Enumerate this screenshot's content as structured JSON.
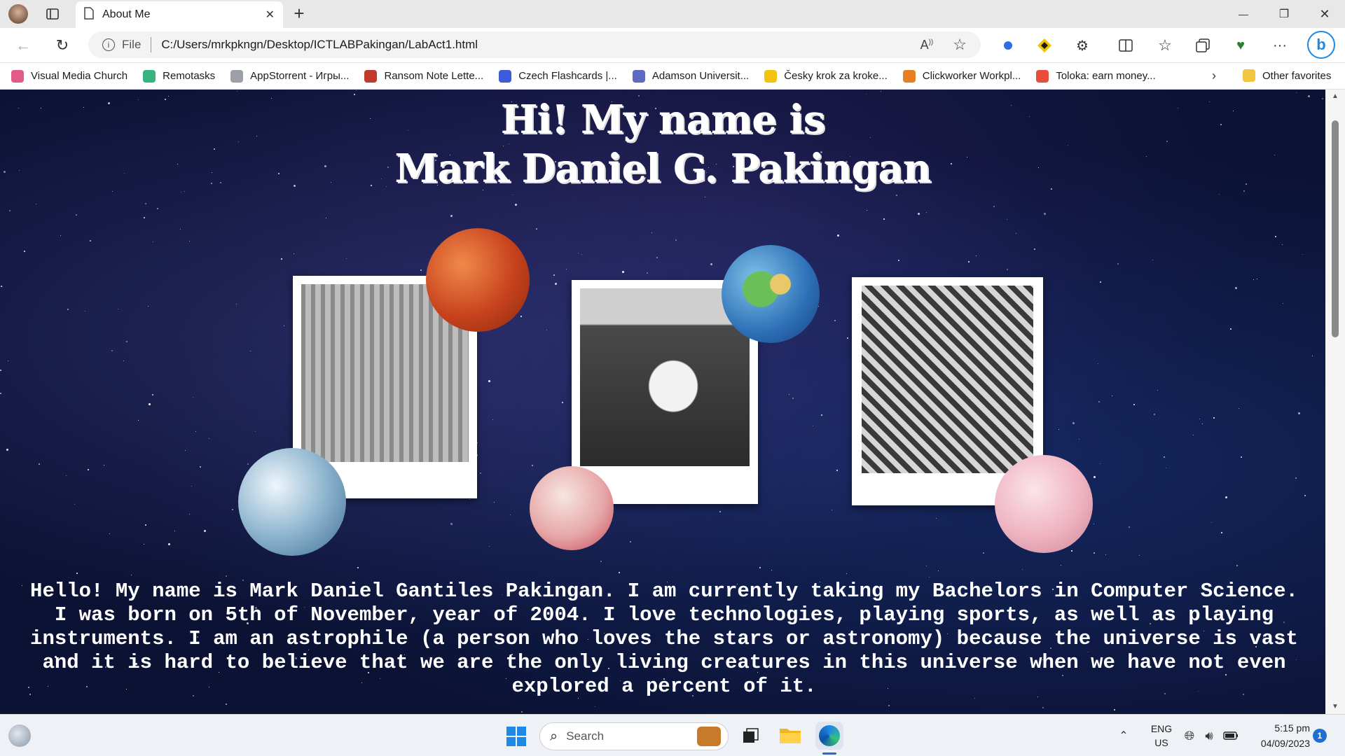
{
  "tab": {
    "title": "About Me",
    "close": "✕",
    "new_tab": "+"
  },
  "window_controls": {
    "minimize": "—",
    "restore": "❐",
    "close": "✕"
  },
  "address": {
    "scheme": "File",
    "url": "C:/Users/mrkpkngn/Desktop/ICTLABPakingan/LabAct1.html"
  },
  "favorites": [
    {
      "label": "Visual Media Church",
      "color": "#e25a8a"
    },
    {
      "label": "Remotasks",
      "color": "#36b37e"
    },
    {
      "label": "AppStorrent - Игры...",
      "color": "#9aa0a6"
    },
    {
      "label": "Ransom Note Lette...",
      "color": "#c0392b"
    },
    {
      "label": "Czech Flashcards |...",
      "color": "#3b5bdb"
    },
    {
      "label": "Adamson Universit...",
      "color": "#5c6bc0"
    },
    {
      "label": "Česky krok za kroke...",
      "color": "#f1c40f"
    },
    {
      "label": "Clickworker Workpl...",
      "color": "#e67e22"
    },
    {
      "label": "Toloka: earn money...",
      "color": "#e74c3c"
    }
  ],
  "other_favorites": "Other favorites",
  "page": {
    "heading_line1": "Hi! My name is",
    "heading_line2": "Mark Daniel G. Pakingan",
    "bio": "Hello! My name is Mark Daniel Gantiles Pakingan. I am currently taking my Bachelors in Computer Science. I was born on 5th of November, year of 2004. I love technologies, playing sports, as well as playing instruments. I am an astrophile (a person who loves the stars or astronomy) because the universe is vast and it is hard to believe that we are the only living creatures in this universe when we have not even explored a percent of it."
  },
  "taskbar": {
    "search_label": "Search",
    "lang_top": "ENG",
    "lang_bottom": "US",
    "time": "5:15 pm",
    "date": "04/09/2023",
    "notification_count": "1"
  }
}
